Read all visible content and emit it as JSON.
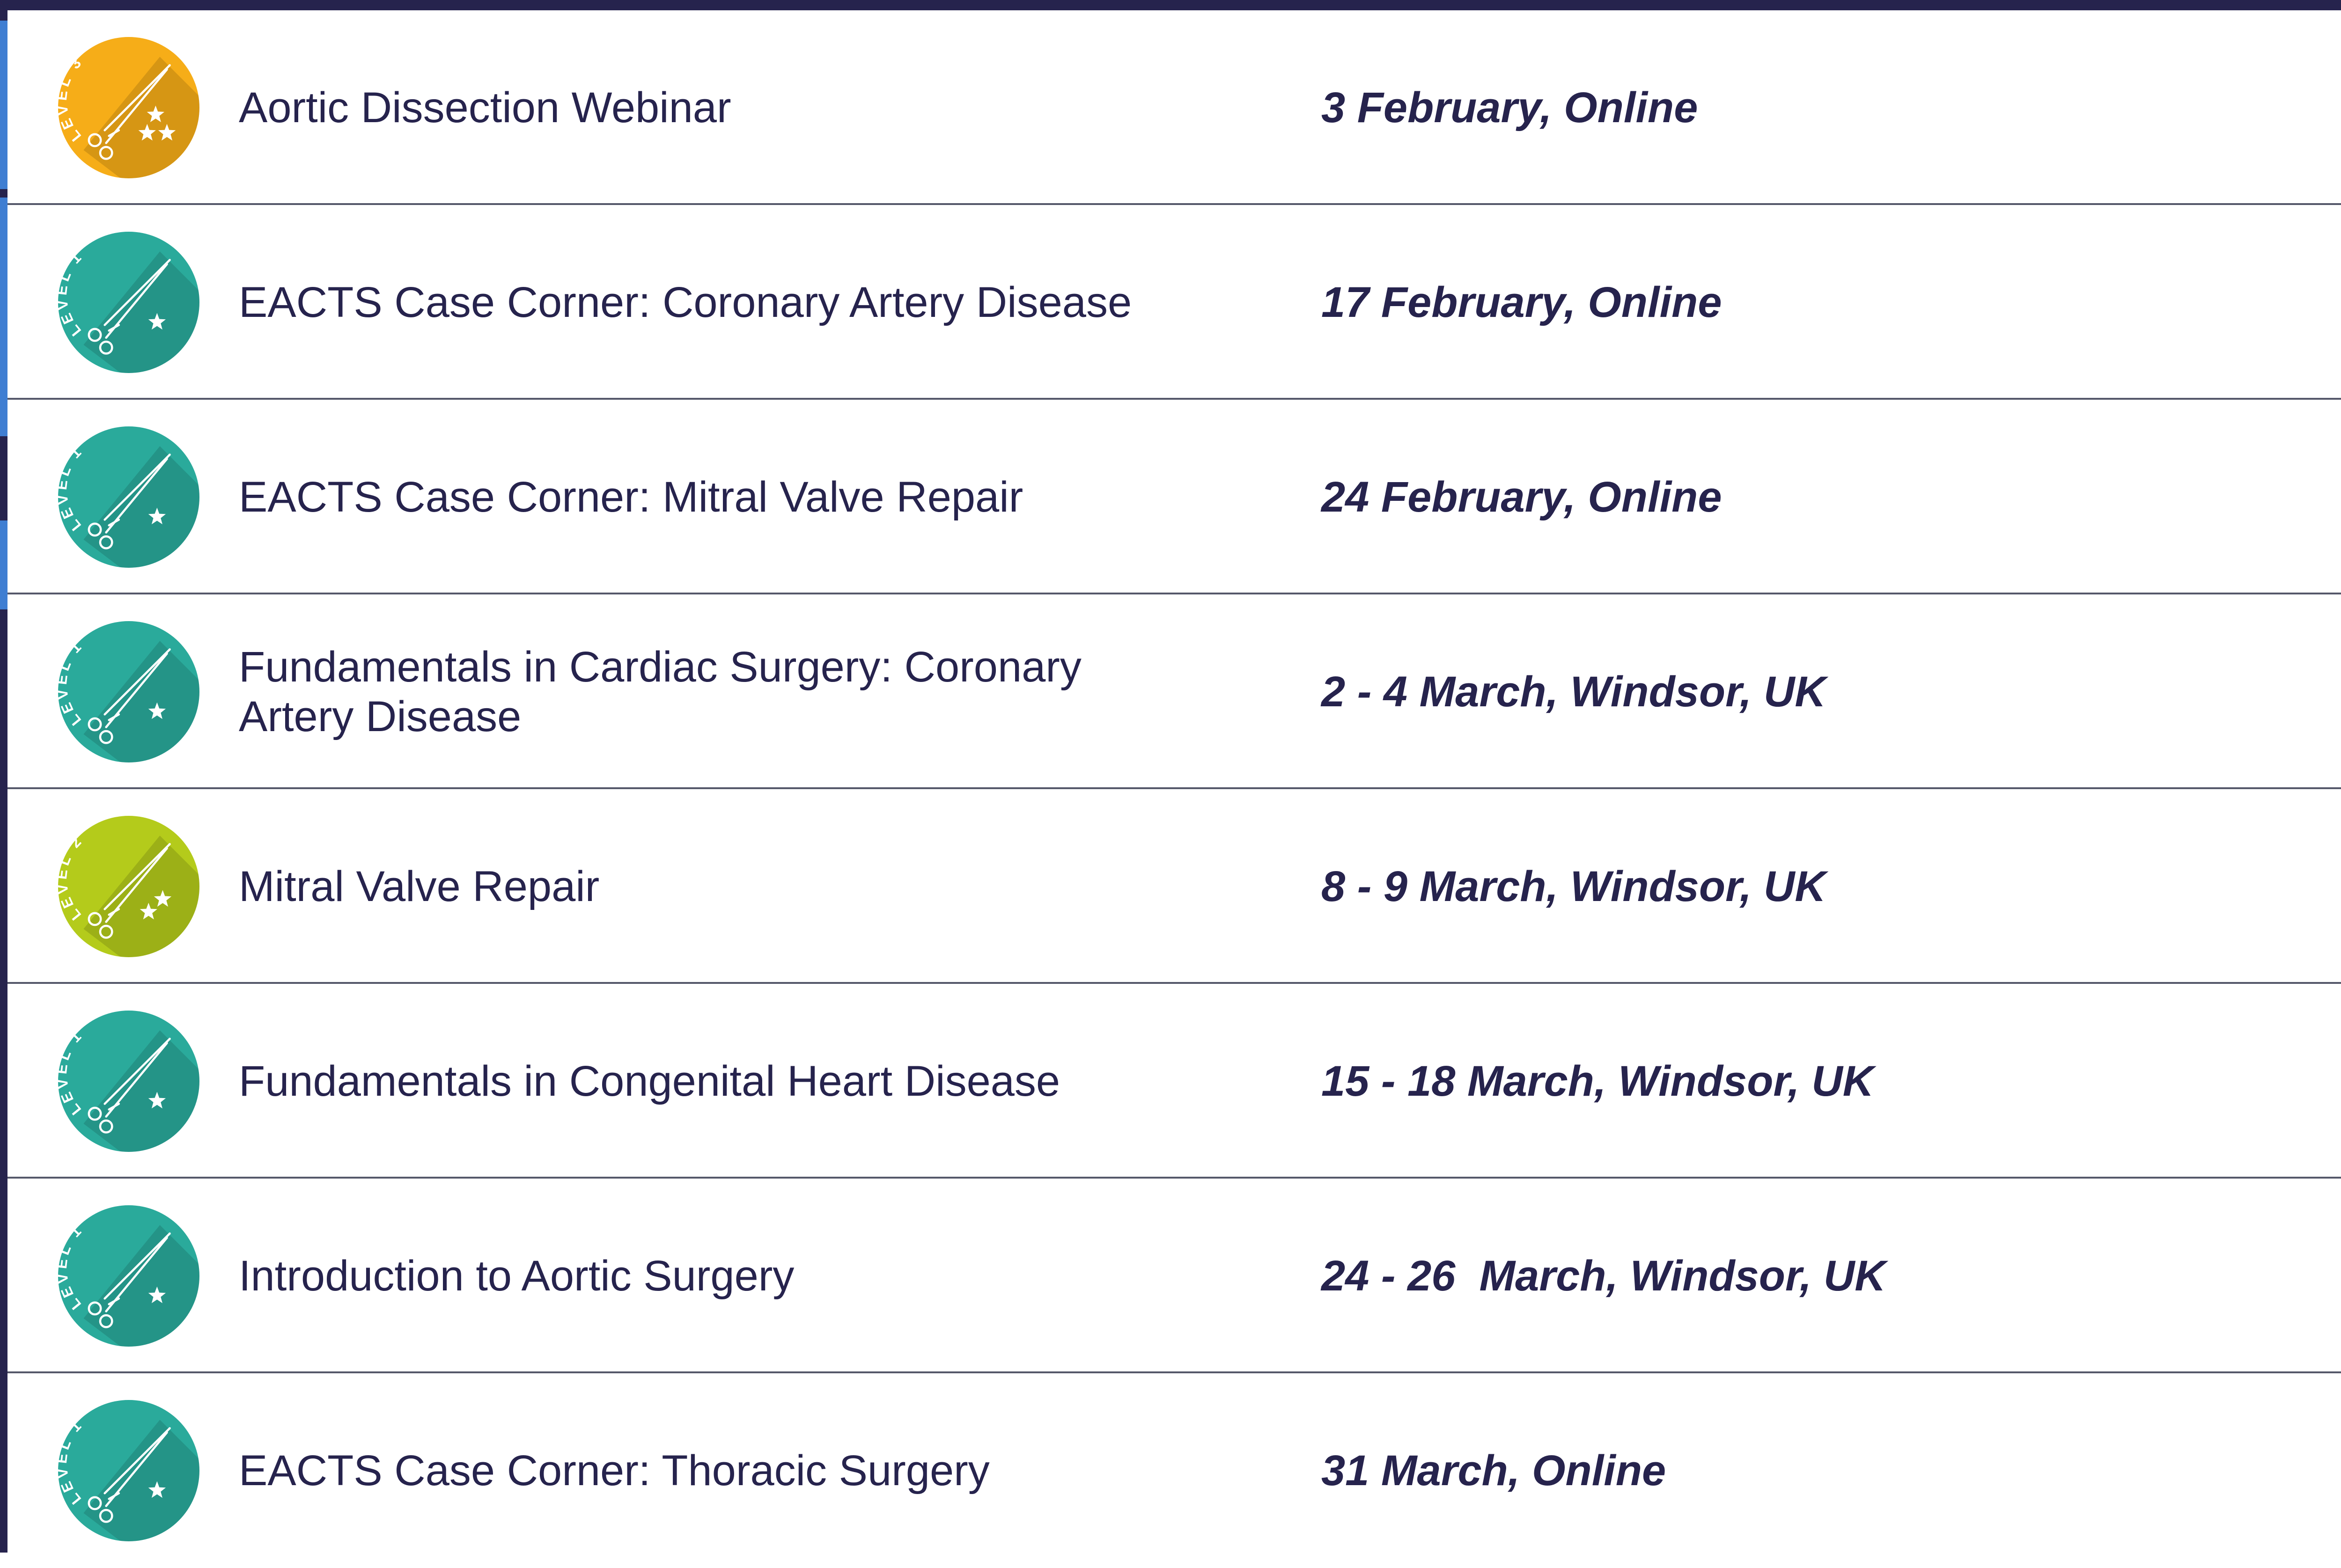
{
  "colors": {
    "text": "#26234d",
    "divider": "#55586a",
    "frame": "#26234d",
    "accent_strip": "#3f7ed2",
    "level_1": "#2aaa9b",
    "level_2": "#b4cb1b",
    "level_3": "#f6ad18"
  },
  "events": [
    {
      "title": "Aortic Dissection Webinar",
      "date": "3 February, Online",
      "level_label": "LEVEL 3",
      "level": 3,
      "icon": "level-3-badge-icon"
    },
    {
      "title": "EACTS Case Corner: Coronary Artery Disease",
      "date": "17 February, Online",
      "level_label": "LEVEL 1",
      "level": 1,
      "icon": "level-1-badge-icon"
    },
    {
      "title": "EACTS Case Corner: Mitral Valve Repair",
      "date": "24 February, Online",
      "level_label": "LEVEL 1",
      "level": 1,
      "icon": "level-1-badge-icon"
    },
    {
      "title": "Fundamentals in Cardiac Surgery: Coronary Artery Disease",
      "date": "2 - 4 March, Windsor, UK",
      "level_label": "LEVEL 1",
      "level": 1,
      "icon": "level-1-badge-icon"
    },
    {
      "title": "Mitral Valve Repair",
      "date": "8 - 9 March, Windsor, UK",
      "level_label": "LEVEL 2",
      "level": 2,
      "icon": "level-2-badge-icon"
    },
    {
      "title": "Fundamentals in Congenital Heart Disease",
      "date": "15 - 18 March, Windsor, UK",
      "level_label": "LEVEL 1",
      "level": 1,
      "icon": "level-1-badge-icon"
    },
    {
      "title": "Introduction to Aortic Surgery",
      "date": "24 - 26  March, Windsor, UK",
      "level_label": "LEVEL 1",
      "level": 1,
      "icon": "level-1-badge-icon"
    },
    {
      "title": "EACTS Case Corner: Thoracic Surgery",
      "date": "31 March, Online",
      "level_label": "LEVEL 1",
      "level": 1,
      "icon": "level-1-badge-icon"
    }
  ]
}
